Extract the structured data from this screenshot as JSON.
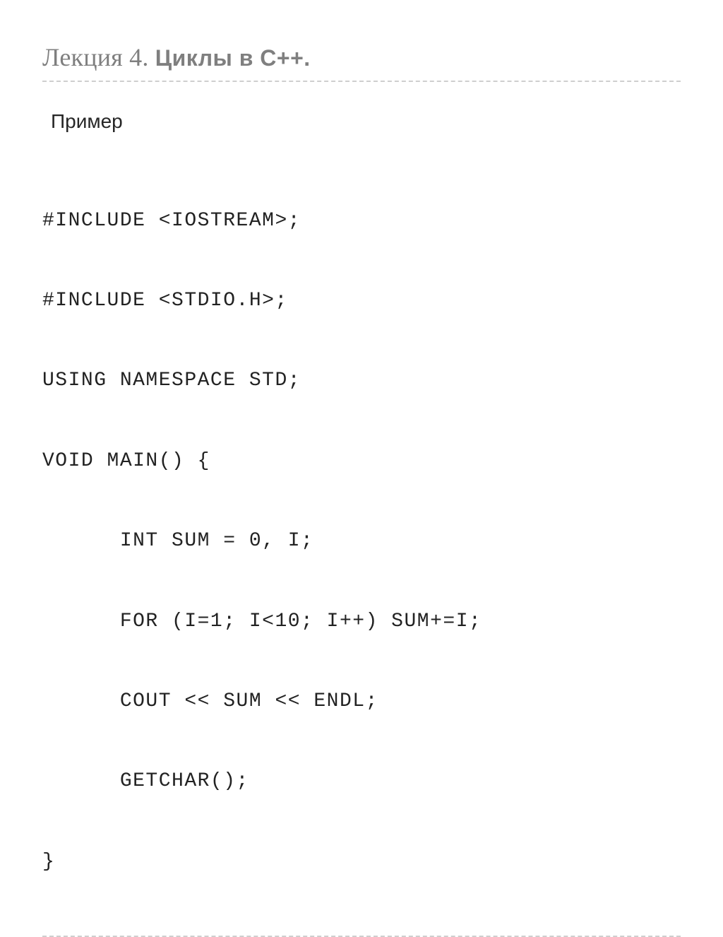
{
  "title": {
    "prefix": "Лекция 4. ",
    "bold": "Циклы в С++."
  },
  "example_label": "Пример",
  "code_lines": [
    "#INCLUDE <IOSTREAM>;",
    "#INCLUDE <STDIO.H>;",
    "USING NAMESPACE STD;",
    "VOID MAIN() {",
    "      INT SUM = 0, I;",
    "      FOR (I=1; I<10; I++) SUM+=I;",
    "      COUT << SUM << ENDL;",
    "      GETCHAR();",
    "}"
  ]
}
